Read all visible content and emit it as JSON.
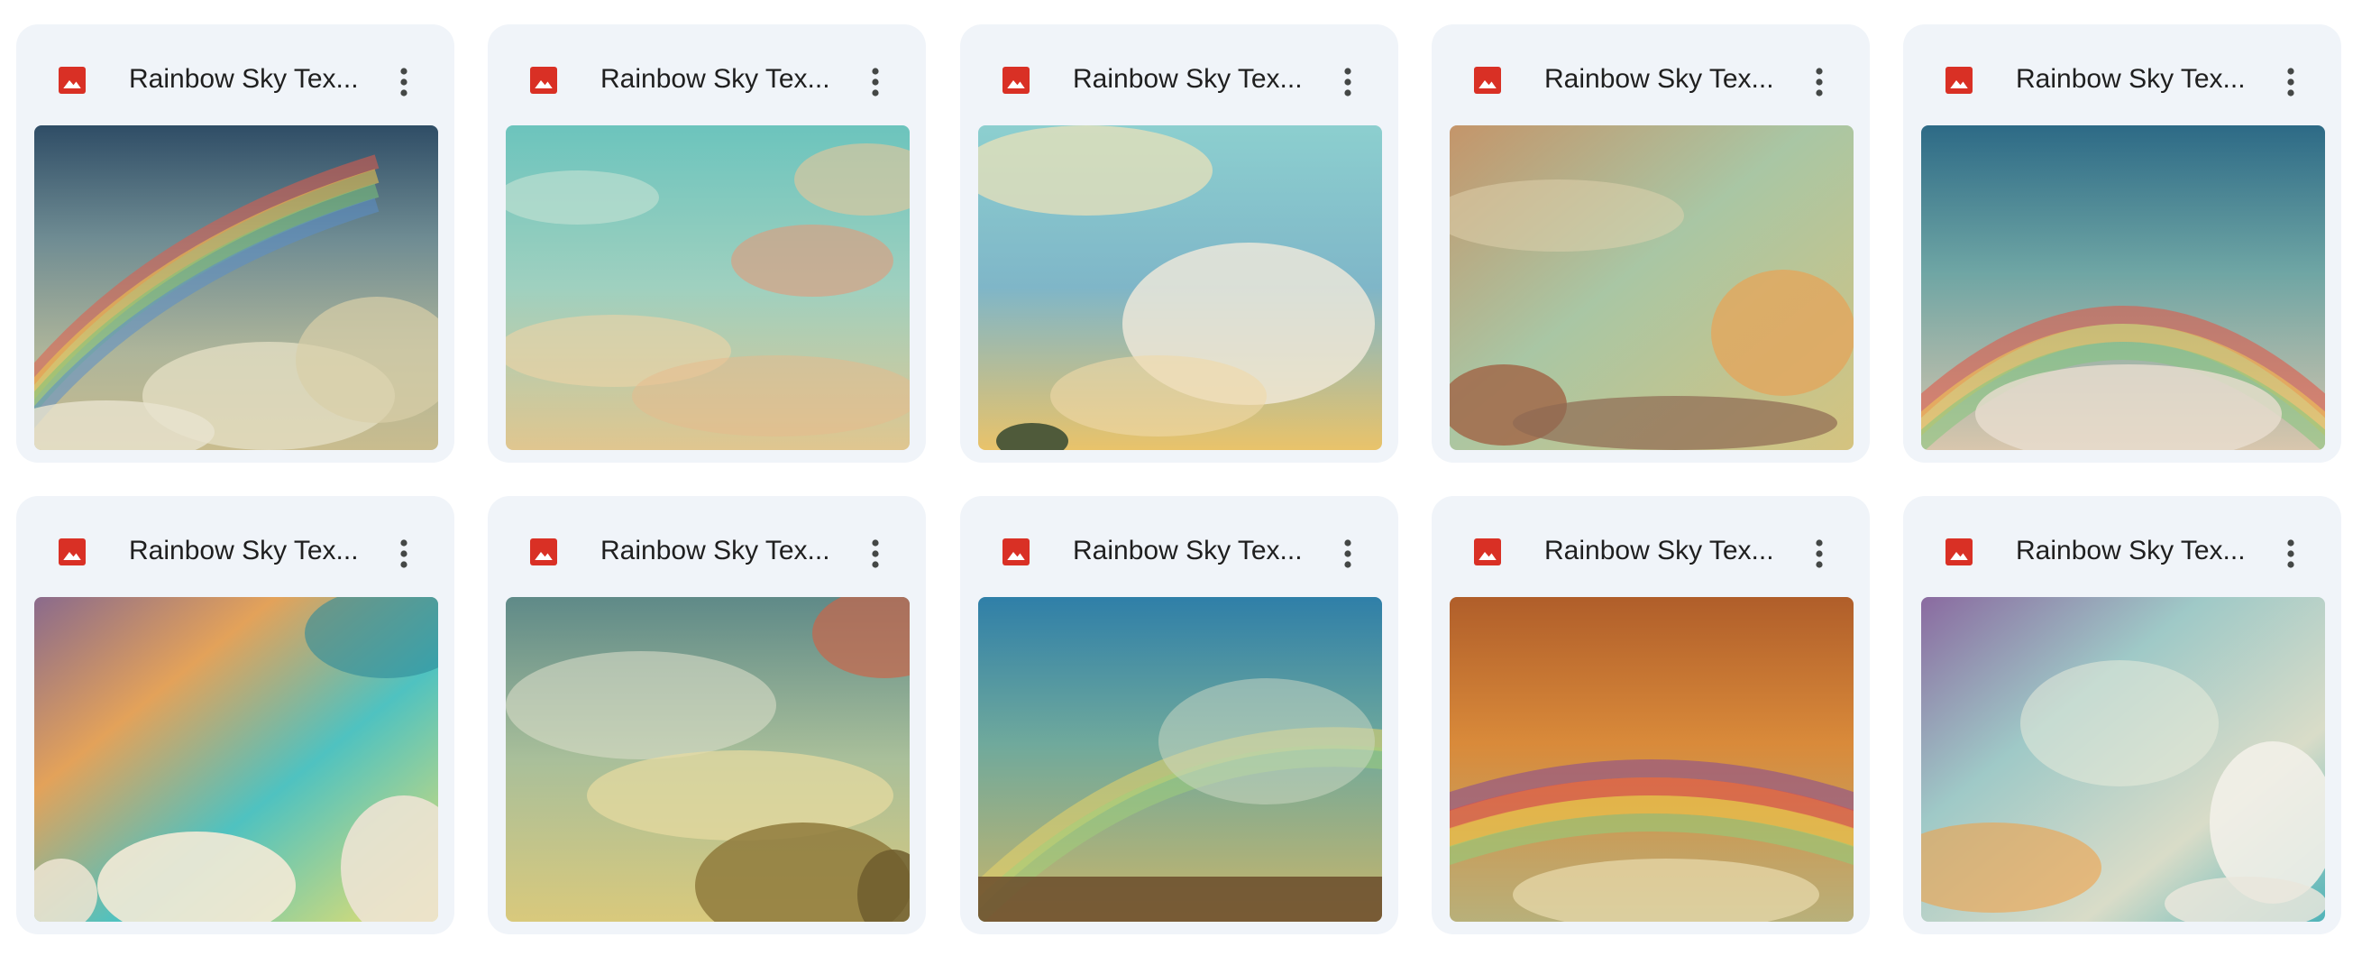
{
  "colors": {
    "card_background": "#f0f4f9",
    "title_text": "#1f1f1f",
    "image_icon": "#d93025",
    "more_icon": "#444746"
  },
  "files": [
    {
      "name": "Rainbow Sky Tex...",
      "file_type_icon": "image-icon",
      "thumbnail": "rainbow-sky-texture-1"
    },
    {
      "name": "Rainbow Sky Tex...",
      "file_type_icon": "image-icon",
      "thumbnail": "rainbow-sky-texture-2"
    },
    {
      "name": "Rainbow Sky Tex...",
      "file_type_icon": "image-icon",
      "thumbnail": "rainbow-sky-texture-3"
    },
    {
      "name": "Rainbow Sky Tex...",
      "file_type_icon": "image-icon",
      "thumbnail": "rainbow-sky-texture-4"
    },
    {
      "name": "Rainbow Sky Tex...",
      "file_type_icon": "image-icon",
      "thumbnail": "rainbow-sky-texture-5"
    },
    {
      "name": "Rainbow Sky Tex...",
      "file_type_icon": "image-icon",
      "thumbnail": "rainbow-sky-texture-6"
    },
    {
      "name": "Rainbow Sky Tex...",
      "file_type_icon": "image-icon",
      "thumbnail": "rainbow-sky-texture-7"
    },
    {
      "name": "Rainbow Sky Tex...",
      "file_type_icon": "image-icon",
      "thumbnail": "rainbow-sky-texture-8"
    },
    {
      "name": "Rainbow Sky Tex...",
      "file_type_icon": "image-icon",
      "thumbnail": "rainbow-sky-texture-9"
    },
    {
      "name": "Rainbow Sky Tex...",
      "file_type_icon": "image-icon",
      "thumbnail": "rainbow-sky-texture-10"
    }
  ]
}
